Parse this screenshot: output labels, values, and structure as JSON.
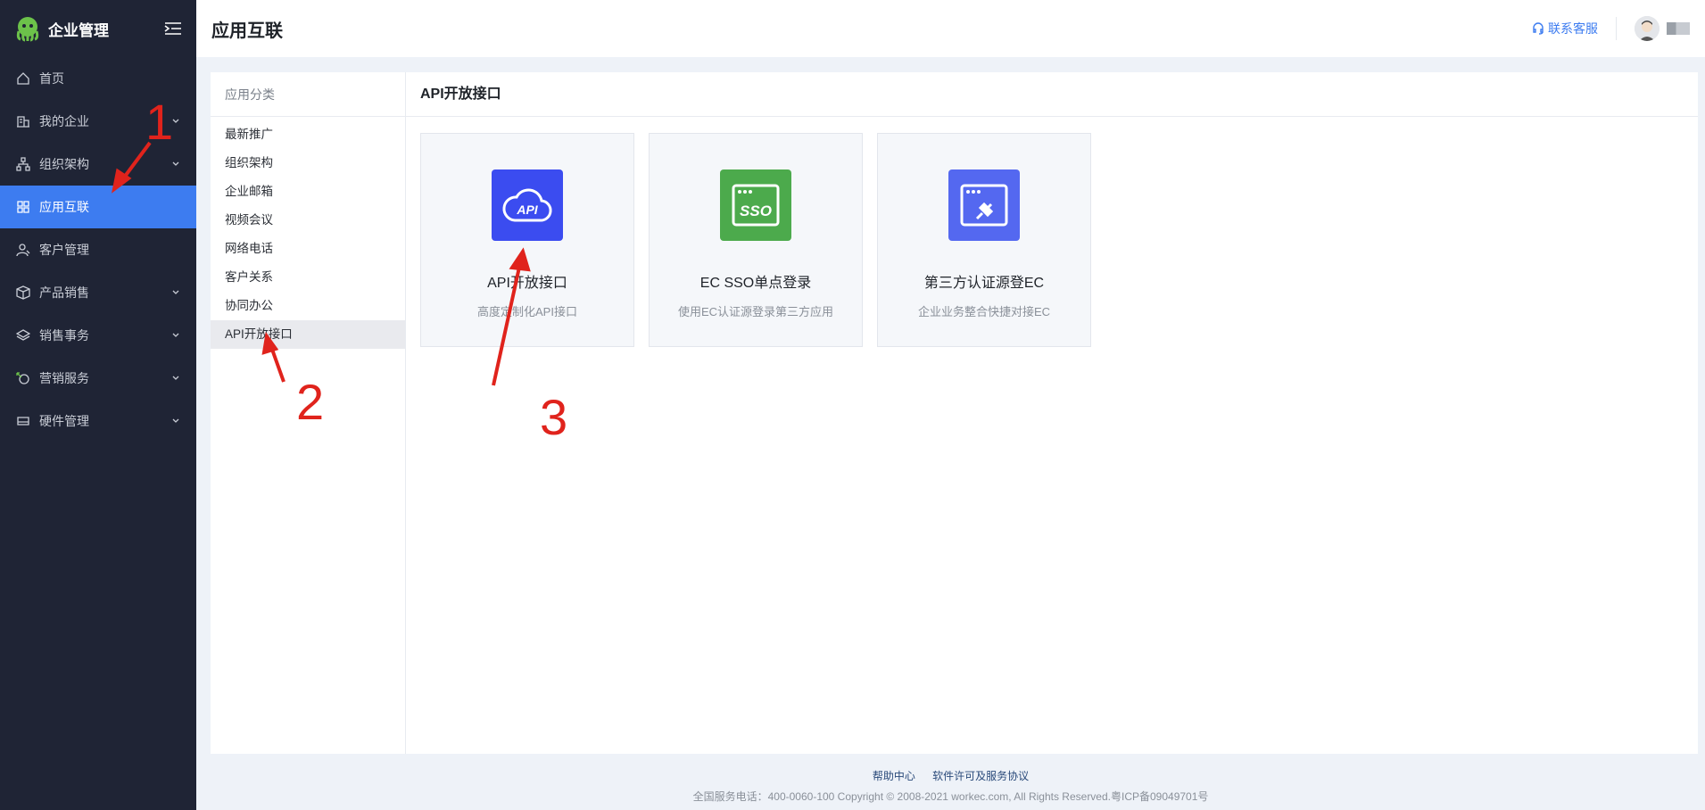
{
  "sidebar": {
    "brand": "企业管理",
    "items": [
      {
        "label": "首页",
        "icon": "home-icon",
        "has_chevron": false
      },
      {
        "label": "我的企业",
        "icon": "building-icon",
        "has_chevron": true
      },
      {
        "label": "组织架构",
        "icon": "org-chart-icon",
        "has_chevron": true
      },
      {
        "label": "应用互联",
        "icon": "apps-icon",
        "has_chevron": false,
        "active": true
      },
      {
        "label": "客户管理",
        "icon": "customer-icon",
        "has_chevron": false
      },
      {
        "label": "产品销售",
        "icon": "box-icon",
        "has_chevron": true
      },
      {
        "label": "销售事务",
        "icon": "layers-icon",
        "has_chevron": true
      },
      {
        "label": "营销服务",
        "icon": "marketing-icon",
        "has_chevron": true
      },
      {
        "label": "硬件管理",
        "icon": "hardware-icon",
        "has_chevron": true
      }
    ]
  },
  "header": {
    "title": "应用互联",
    "service_label": "联系客服"
  },
  "categories": {
    "title": "应用分类",
    "items": [
      "最新推广",
      "组织架构",
      "企业邮箱",
      "视频会议",
      "网络电话",
      "客户关系",
      "协同办公",
      "API开放接口"
    ],
    "active_index": 7
  },
  "content": {
    "title": "API开放接口",
    "cards": [
      {
        "name": "API开放接口",
        "desc": "高度定制化API接口",
        "icon": "api-cloud-icon",
        "color": "#3b4cf0"
      },
      {
        "name": "EC SSO单点登录",
        "desc": "使用EC认证源登录第三方应用",
        "icon": "sso-icon",
        "color": "#4caa4c"
      },
      {
        "name": "第三方认证源登EC",
        "desc": "企业业务整合快捷对接EC",
        "icon": "plug-window-icon",
        "color": "#5468f0"
      }
    ]
  },
  "footer": {
    "help": "帮助中心",
    "license": "软件许可及服务协议",
    "copyright": "全国服务电话：400-0060-100 Copyright © 2008-2021 workec.com, All Rights Reserved.粤ICP备09049701号"
  },
  "annotations": {
    "step1": "1",
    "step2": "2",
    "step3": "3",
    "color": "#e0231c"
  },
  "colors": {
    "accent": "#3d7cf0",
    "sidebar_bg": "#1f2435"
  }
}
